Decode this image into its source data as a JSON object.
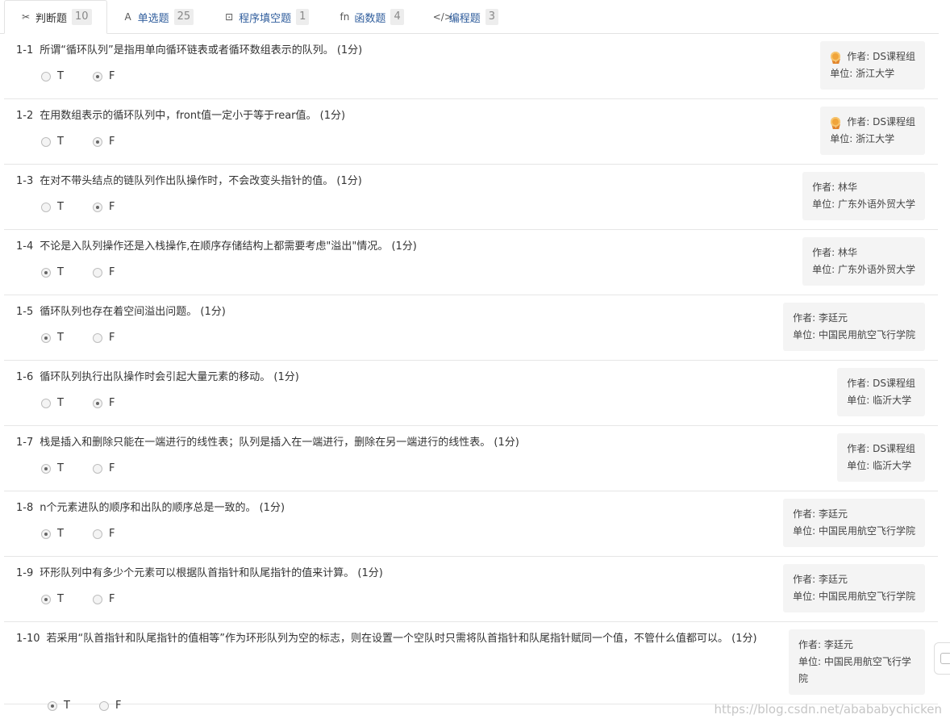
{
  "tabs": [
    {
      "icon": "✂",
      "label": "判断题",
      "count": "10"
    },
    {
      "icon": "A",
      "label": "单选题",
      "count": "25"
    },
    {
      "icon": "⊡",
      "label": "程序填空题",
      "count": "1"
    },
    {
      "icon": "fn",
      "label": "函数题",
      "count": "4"
    },
    {
      "icon": "</>",
      "label": "编程题",
      "count": "3"
    }
  ],
  "options": {
    "true_label": "T",
    "false_label": "F"
  },
  "questions": [
    {
      "num": "1-1",
      "text": "所谓“循环队列”是指用单向循环链表或者循环数组表示的队列。 (1分)",
      "selected": "F",
      "author": "作者: DS课程组",
      "unit": "单位: 浙江大学",
      "badge": true
    },
    {
      "num": "1-2",
      "text": "在用数组表示的循环队列中，front值一定小于等于rear值。 (1分)",
      "selected": "F",
      "author": "作者: DS课程组",
      "unit": "单位: 浙江大学",
      "badge": true
    },
    {
      "num": "1-3",
      "text": "在对不带头结点的链队列作出队操作时，不会改变头指针的值。 (1分)",
      "selected": "F",
      "author": "作者: 林华",
      "unit": "单位: 广东外语外贸大学",
      "badge": false
    },
    {
      "num": "1-4",
      "text": "不论是入队列操作还是入栈操作,在顺序存储结构上都需要考虑\"溢出\"情况。 (1分)",
      "selected": "T",
      "author": "作者: 林华",
      "unit": "单位: 广东外语外贸大学",
      "badge": false
    },
    {
      "num": "1-5",
      "text": "循环队列也存在着空间溢出问题。 (1分)",
      "selected": "T",
      "author": "作者: 李廷元",
      "unit": "单位: 中国民用航空飞行学院",
      "badge": false
    },
    {
      "num": "1-6",
      "text": "循环队列执行出队操作时会引起大量元素的移动。 (1分)",
      "selected": "F",
      "author": "作者: DS课程组",
      "unit": "单位: 临沂大学",
      "badge": false
    },
    {
      "num": "1-7",
      "text": "栈是插入和删除只能在一端进行的线性表；队列是插入在一端进行，删除在另一端进行的线性表。 (1分)",
      "selected": "T",
      "author": "作者: DS课程组",
      "unit": "单位: 临沂大学",
      "badge": false
    },
    {
      "num": "1-8",
      "text": "n个元素进队的顺序和出队的顺序总是一致的。 (1分)",
      "selected": "T",
      "author": "作者: 李廷元",
      "unit": "单位: 中国民用航空飞行学院",
      "badge": false
    },
    {
      "num": "1-9",
      "text": "环形队列中有多少个元素可以根据队首指针和队尾指针的值来计算。 (1分)",
      "selected": "T",
      "author": "作者: 李廷元",
      "unit": "单位: 中国民用航空飞行学院",
      "badge": false
    },
    {
      "num": "1-10",
      "text": "若采用“队首指针和队尾指针的值相等”作为环形队列为空的标志，则在设置一个空队时只需将队首指针和队尾指针赋同一个值，不管什么值都可以。 (1分)",
      "selected": "T",
      "author": "作者: 李廷元",
      "unit": "单位: 中国民用航空飞行学院",
      "badge": false
    }
  ],
  "watermark": "https://blog.csdn.net/abababychicken"
}
